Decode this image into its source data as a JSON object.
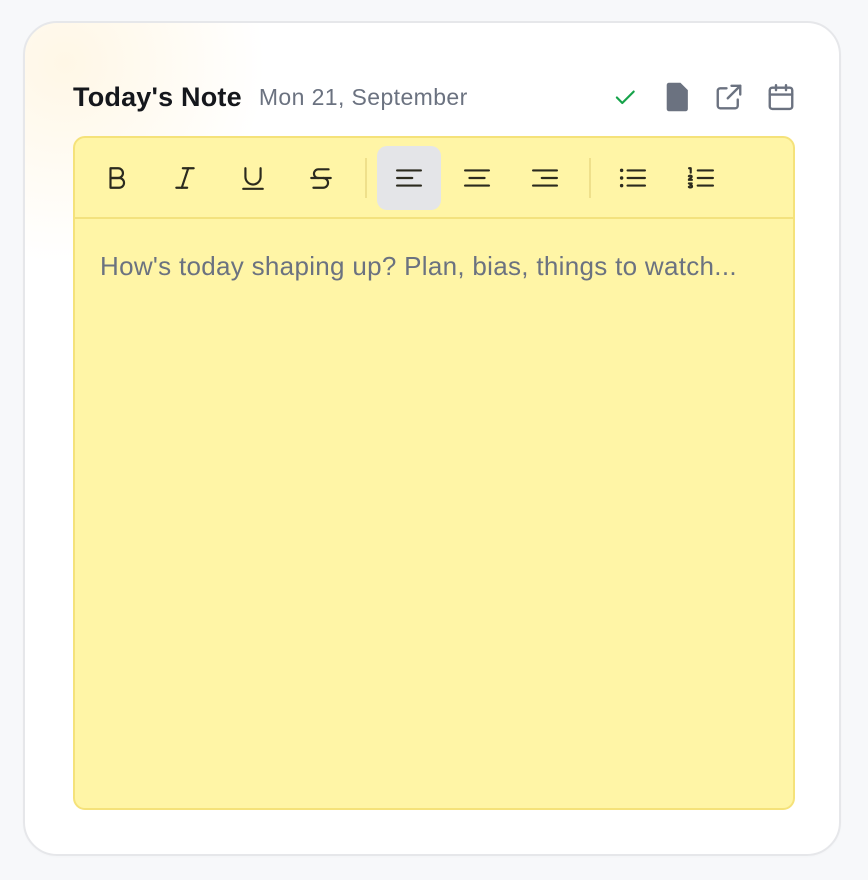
{
  "note": {
    "title": "Today's Note",
    "date": "Mon 21, September"
  },
  "header_icons": [
    "check-icon",
    "document-icon",
    "external-link-icon",
    "calendar-icon"
  ],
  "toolbar": {
    "buttons": [
      "bold",
      "italic",
      "underline",
      "strikethrough",
      "align-left",
      "align-center",
      "align-right",
      "bullet-list",
      "numbered-list"
    ],
    "active": "align-left"
  },
  "editor": {
    "placeholder": "How's today shaping up? Plan, bias, things to watch..."
  },
  "colors": {
    "editor_bg": "#fff5a6",
    "editor_border": "#f5e27a",
    "check": "#16a34a",
    "icon": "#6b7280",
    "toolbar_icon": "#2b2a1e"
  }
}
